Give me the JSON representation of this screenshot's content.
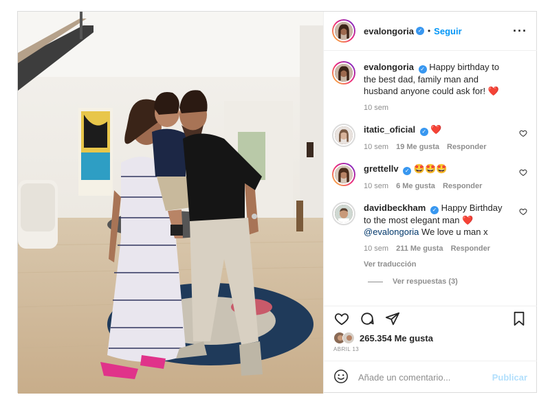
{
  "post": {
    "author": "evalongoria",
    "follow_label": "Seguir",
    "dot": "•",
    "more_icon": "more-horizontal-icon"
  },
  "caption": {
    "user": "evalongoria",
    "text": "Happy birthday to the best dad, family man and husband anyone could ask for!",
    "emoji": "❤️",
    "time": "10 sem"
  },
  "comments": [
    {
      "user": "itatic_oficial",
      "text": "",
      "emoji": "❤️",
      "time": "10 sem",
      "likes": "19 Me gusta",
      "reply_label": "Responder"
    },
    {
      "user": "grettellv",
      "text": "",
      "emoji": "🤩🤩🤩",
      "time": "10 sem",
      "likes": "6 Me gusta",
      "reply_label": "Responder"
    },
    {
      "user": "davidbeckham",
      "text": "Happy Birthday to the most elegant man",
      "emoji": "❤️",
      "mention": "@evalongoria",
      "text_after": "We love u man x",
      "time": "10 sem",
      "likes": "211 Me gusta",
      "reply_label": "Responder",
      "translate_label": "Ver traducción",
      "view_replies": "Ver respuestas (3)"
    }
  ],
  "likes": {
    "count": "265.354 Me gusta",
    "date": "ABRIL 13"
  },
  "add_comment": {
    "placeholder": "Añade un comentario...",
    "publish_label": "Publicar"
  },
  "colors": {
    "accent": "#0095f6",
    "verified": "#3897f0",
    "heart": "#ed4956",
    "muted": "#8e8e8e"
  }
}
